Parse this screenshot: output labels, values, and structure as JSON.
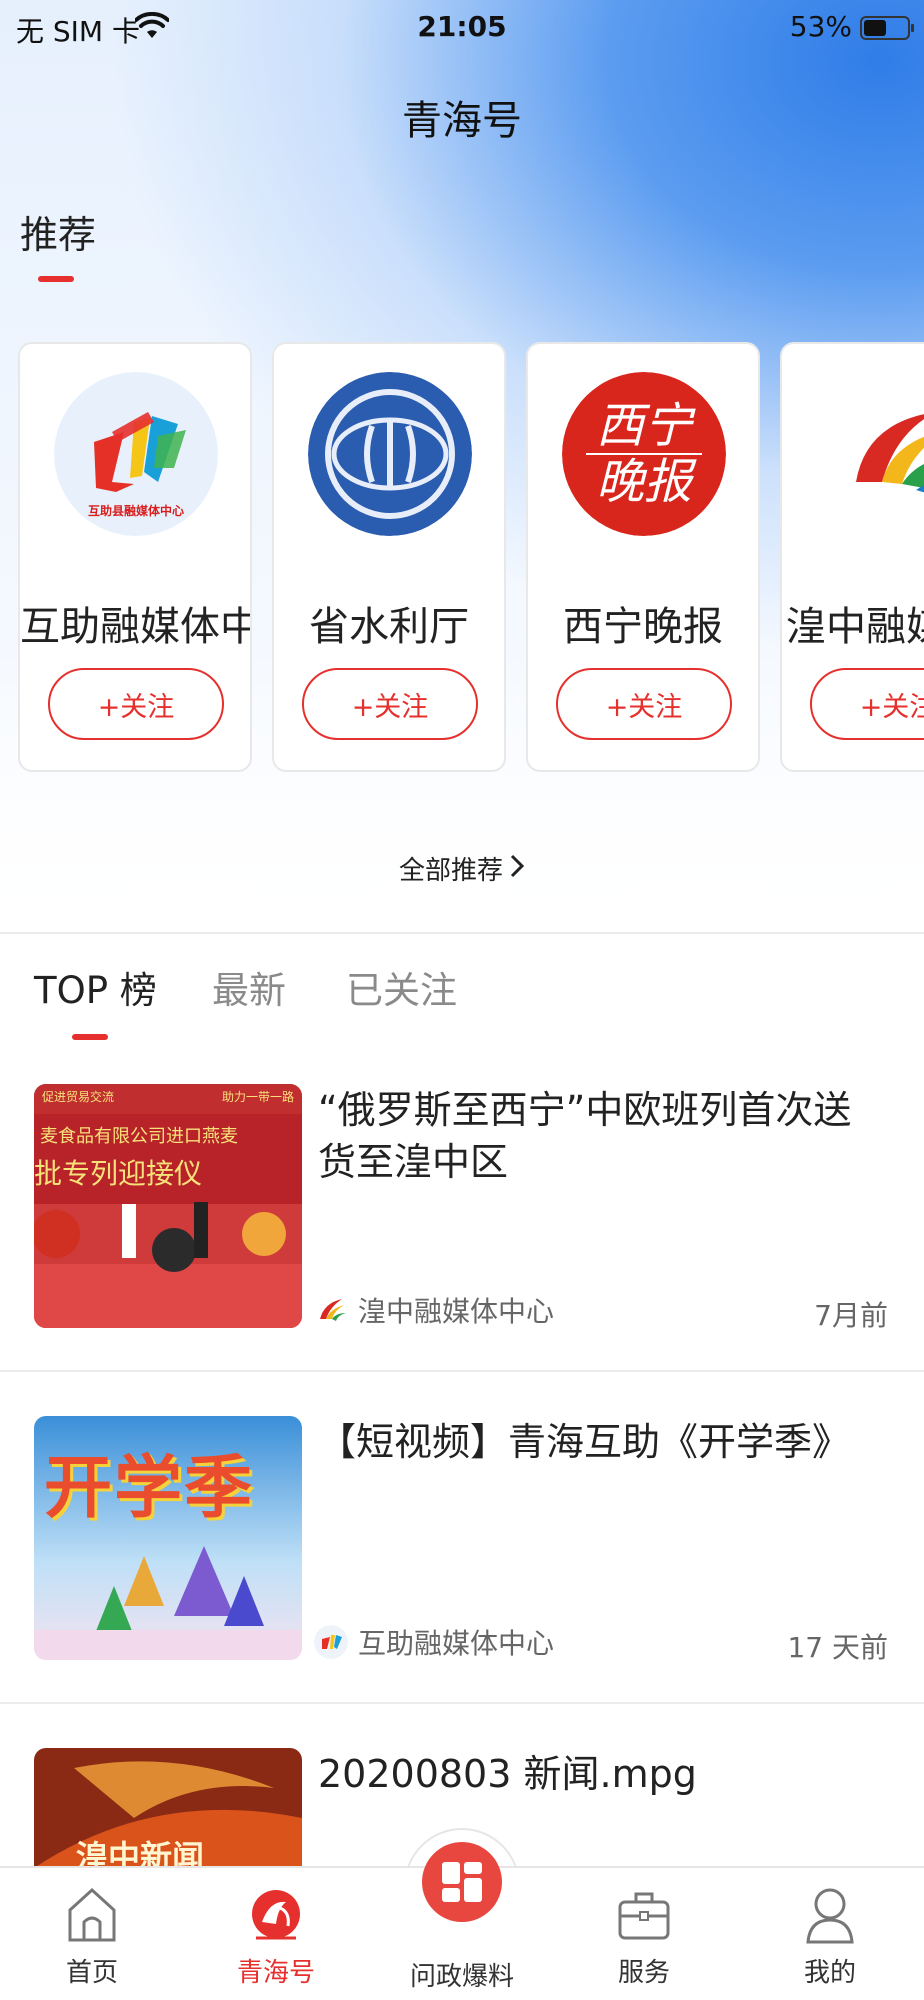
{
  "status_bar": {
    "carrier": "无 SIM 卡",
    "time": "21:05",
    "battery_percent": "53%",
    "battery_level": 0.53
  },
  "header": {
    "title": "青海号"
  },
  "recommend": {
    "title": "推荐",
    "accounts": [
      {
        "name": "互助融媒体中",
        "follow_label": "+关注",
        "logo_text": "互助县融媒体中心"
      },
      {
        "name": "省水利厅",
        "follow_label": "+关注"
      },
      {
        "name": "西宁晚报",
        "follow_label": "+关注",
        "logo_text": "西宁晚报"
      },
      {
        "name": "湟中融媒",
        "follow_label": "+关注"
      }
    ],
    "all_label": "全部推荐"
  },
  "tabs": [
    {
      "label": "TOP 榜",
      "active": true
    },
    {
      "label": "最新",
      "active": false
    },
    {
      "label": "已关注",
      "active": false
    }
  ],
  "news": [
    {
      "headline": "“俄罗斯至西宁”中欧班列首次送货至湟中区",
      "source": "湟中融媒体中心",
      "time": "7月前",
      "thumb_text": [
        "促进贸易交流",
        "助力一带一路",
        "麦食品有限公司进口燕麦",
        "批专列迎接仪"
      ]
    },
    {
      "headline": "【短视频】青海互助《开学季》",
      "source": "互助融媒体中心",
      "time": "17 天前",
      "thumb_text": [
        "开学季"
      ]
    },
    {
      "headline": "20200803 新闻.mpg",
      "source": "",
      "time": "",
      "thumb_text": [
        "湟中新闻"
      ]
    }
  ],
  "bottom_nav": [
    {
      "label": "首页",
      "icon": "home-icon",
      "active": false
    },
    {
      "label": "青海号",
      "icon": "qinghai-icon",
      "active": true
    },
    {
      "label": "问政爆料",
      "icon": "grid-icon",
      "active": false
    },
    {
      "label": "服务",
      "icon": "briefcase-icon",
      "active": false
    },
    {
      "label": "我的",
      "icon": "user-icon",
      "active": false
    }
  ],
  "colors": {
    "accent": "#e5302d",
    "blue": "#2f7de8"
  }
}
